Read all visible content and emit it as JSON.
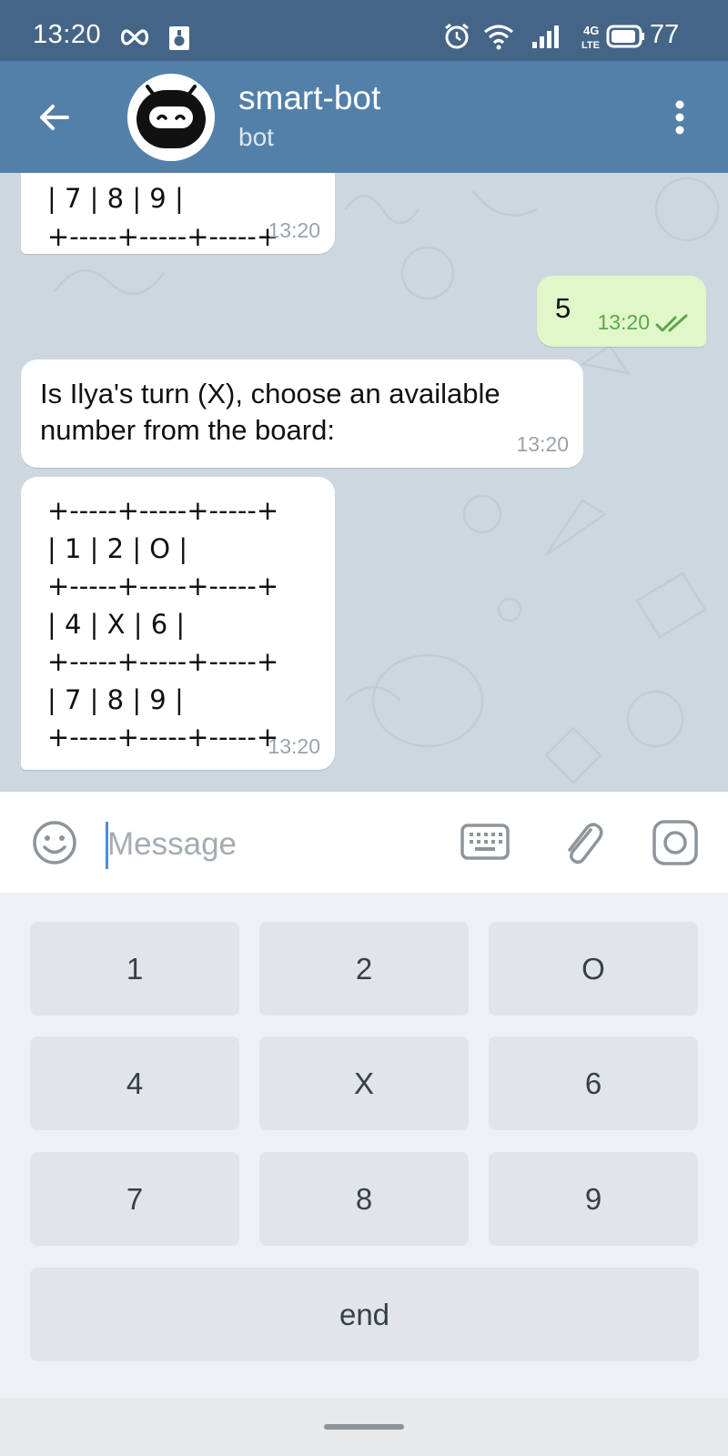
{
  "status_bar": {
    "time": "13:20",
    "battery": "77",
    "network": "4G LTE",
    "icons": [
      "infinity-icon",
      "notification-icon",
      "alarm-icon",
      "wifi-icon",
      "signal-icon",
      "network-type-icon",
      "battery-icon"
    ]
  },
  "header": {
    "title": "smart-bot",
    "subtitle": "bot",
    "icons": [
      "back-arrow-icon",
      "bot-avatar",
      "more-vert-icon"
    ]
  },
  "messages": [
    {
      "from": "bot",
      "lines": [
        "| 7 | 8 | 9 |",
        "+-----+-----+-----+"
      ],
      "time": "13:20"
    },
    {
      "from": "me",
      "text": "5",
      "time": "13:20",
      "status": "read"
    },
    {
      "from": "bot",
      "lines": [
        "Is Ilya's turn (X), choose an available",
        "number from the board:"
      ],
      "time": "13:20"
    },
    {
      "from": "bot",
      "lines": [
        "+-----+-----+-----+",
        "| 1 | 2 | O |",
        "+-----+-----+-----+",
        "| 4 | X | 6 |",
        "+-----+-----+-----+",
        "| 7 | 8 | 9 |",
        "+-----+-----+-----+"
      ],
      "time": "13:20"
    }
  ],
  "input": {
    "placeholder": "Message",
    "value": ""
  },
  "keyboard": {
    "rows": [
      [
        "1",
        "2",
        "O"
      ],
      [
        "4",
        "X",
        "6"
      ],
      [
        "7",
        "8",
        "9"
      ],
      [
        "end"
      ]
    ]
  },
  "colors": {
    "status_bar": "#456587",
    "header": "#5380a8",
    "chat_bg": "#cdd7df",
    "outgoing_bubble": "#e0f8c9",
    "read_check": "#5fa44d",
    "keyboard_bg": "#eef0f3",
    "key_bg": "#e1e5e9"
  }
}
